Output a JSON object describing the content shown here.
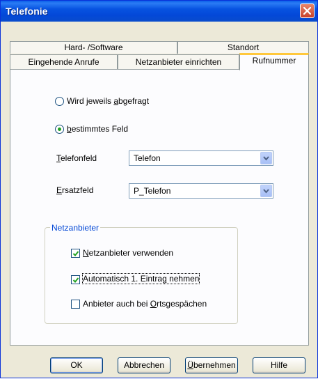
{
  "window": {
    "title": "Telefonie"
  },
  "tabs": {
    "back_row": [
      "Hard- /Software",
      "Standort"
    ],
    "front_row": [
      "Eingehende Anrufe",
      "Netzanbieter einrichten",
      "Rufnummer"
    ],
    "active": "Rufnummer"
  },
  "options": {
    "ask_each_time": {
      "label_pre": "Wird jeweils ",
      "label_acc": "a",
      "label_post": "bgefragt",
      "selected": false
    },
    "specific_field": {
      "label_pre": "",
      "label_acc": "b",
      "label_post": "estimmtes Feld",
      "selected": true
    }
  },
  "phone_field": {
    "label_acc": "T",
    "label_post": "elefonfeld",
    "value": "Telefon"
  },
  "fallback_field": {
    "label_acc": "E",
    "label_post": "rsatzfeld",
    "value": "P_Telefon"
  },
  "provider_group": {
    "title": "Netzanbieter",
    "use_provider": {
      "label_acc": "N",
      "label_post": "etzanbieter verwenden",
      "checked": true
    },
    "auto_first": {
      "label_pre": "Automatisch 1. Eintra",
      "label_acc": "g",
      "label_post": " nehmen",
      "checked": true
    },
    "local_calls": {
      "label_pre": "Anbieter auch bei ",
      "label_acc": "O",
      "label_post": "rtsgespächen",
      "checked": false
    }
  },
  "buttons": {
    "ok": "OK",
    "cancel": "Abbrechen",
    "apply_acc": "Ü",
    "apply_post": "bernehmen",
    "help": "Hilfe"
  }
}
